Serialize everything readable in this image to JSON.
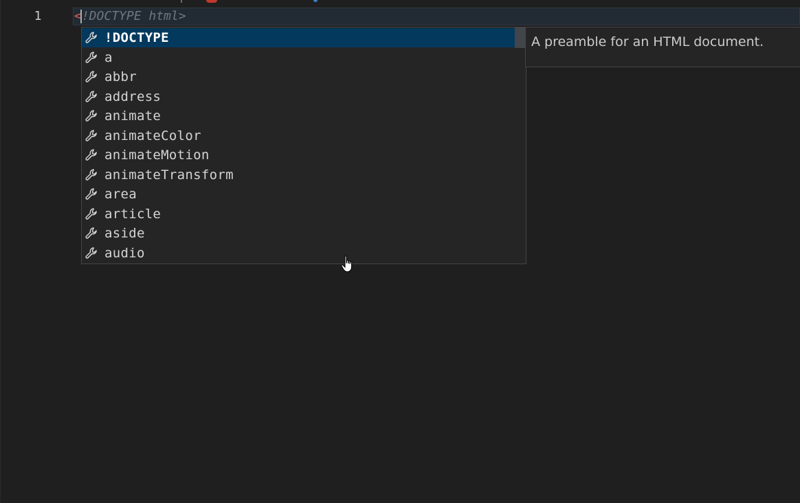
{
  "editor": {
    "line_number": "1",
    "code": {
      "typed": "<",
      "ghost_text": "!DOCTYPE html>"
    }
  },
  "suggest_widget": {
    "items": [
      {
        "label": "!DOCTYPE",
        "icon": "wrench-icon",
        "selected": true
      },
      {
        "label": "a",
        "icon": "wrench-icon"
      },
      {
        "label": "abbr",
        "icon": "wrench-icon"
      },
      {
        "label": "address",
        "icon": "wrench-icon"
      },
      {
        "label": "animate",
        "icon": "wrench-icon"
      },
      {
        "label": "animateColor",
        "icon": "wrench-icon"
      },
      {
        "label": "animateMotion",
        "icon": "wrench-icon"
      },
      {
        "label": "animateTransform",
        "icon": "wrench-icon"
      },
      {
        "label": "area",
        "icon": "wrench-icon"
      },
      {
        "label": "article",
        "icon": "wrench-icon"
      },
      {
        "label": "aside",
        "icon": "wrench-icon"
      },
      {
        "label": "audio",
        "icon": "wrench-icon"
      }
    ],
    "details": "A preamble for an HTML document."
  },
  "colors": {
    "background": "#1f1f1f",
    "selection": "#04395e",
    "bracket": "#e05a5a"
  }
}
